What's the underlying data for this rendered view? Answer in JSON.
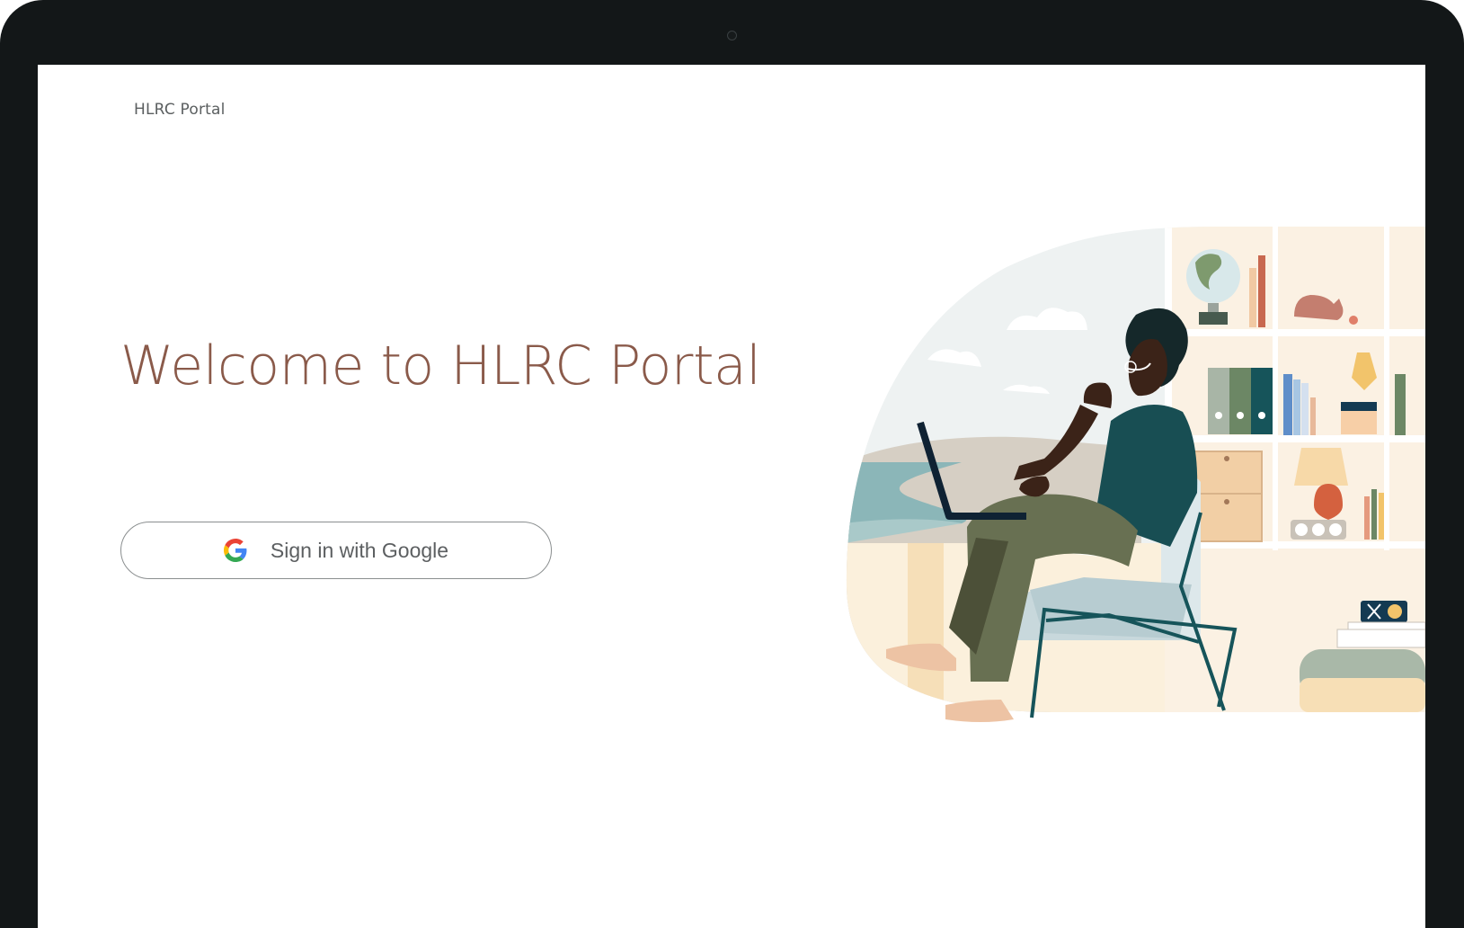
{
  "header": {
    "brand": "HLRC Portal"
  },
  "main": {
    "headline": "Welcome to HLRC Portal",
    "signin_button": {
      "label": "Sign in with Google",
      "icon": "google-g-icon"
    }
  },
  "illustration": {
    "subject": "person-working-on-laptop-illustration"
  },
  "colors": {
    "headline": "#8a5a4a",
    "brand_text": "#5b5f60",
    "button_border": "#8b8f90",
    "device_frame": "#131718",
    "screen_background": "#ffffff"
  }
}
